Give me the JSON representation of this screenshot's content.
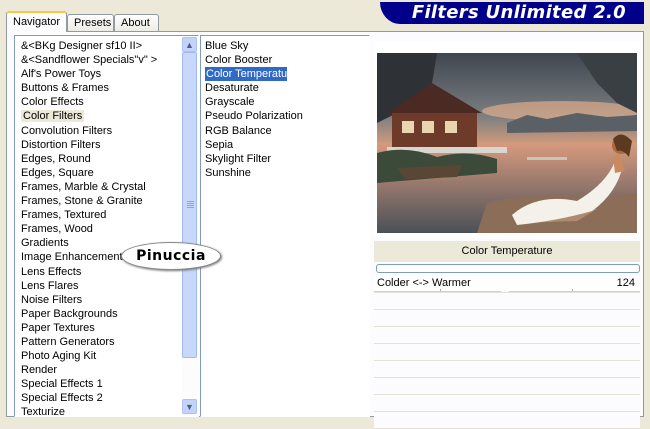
{
  "app": {
    "title": "Filters Unlimited 2.0"
  },
  "tabs": [
    {
      "label": "Navigator",
      "active": true
    },
    {
      "label": "Presets",
      "active": false
    },
    {
      "label": "About",
      "active": false
    }
  ],
  "categories": {
    "items": [
      "&<BKg Designer sf10 II>",
      "&<Sandflower Specials\"v\" >",
      "Alf's Power Toys",
      "Buttons & Frames",
      "Color Effects",
      "Color Filters",
      "Convolution Filters",
      "Distortion Filters",
      "Edges, Round",
      "Edges, Square",
      "Frames, Marble & Crystal",
      "Frames, Stone & Granite",
      "Frames, Textured",
      "Frames, Wood",
      "Gradients",
      "Image Enhancement",
      "Lens Effects",
      "Lens Flares",
      "Noise Filters",
      "Paper Backgrounds",
      "Paper Textures",
      "Pattern Generators",
      "Photo Aging Kit",
      "Render",
      "Special Effects 1",
      "Special Effects 2",
      "Texturize"
    ],
    "selected": "Color Filters"
  },
  "filters": {
    "items": [
      "Blue Sky",
      "Color Booster",
      "Color Temperature",
      "Desaturate",
      "Grayscale",
      "Pseudo Polarization",
      "RGB Balance",
      "Sepia",
      "Skylight Filter",
      "Sunshine"
    ],
    "selected": "Color Temperature"
  },
  "control": {
    "title": "Color Temperature",
    "params": [
      {
        "label": "Colder <-> Warmer",
        "value": "124"
      }
    ]
  },
  "watermark": {
    "text": "Pinuccia"
  },
  "icons": {
    "scroll_up": "chevron-up-icon",
    "scroll_down": "chevron-down-icon"
  },
  "colors": {
    "banner": "#00008a",
    "selection": "#316ac5",
    "active_tab_accent": "#ffc83c"
  }
}
